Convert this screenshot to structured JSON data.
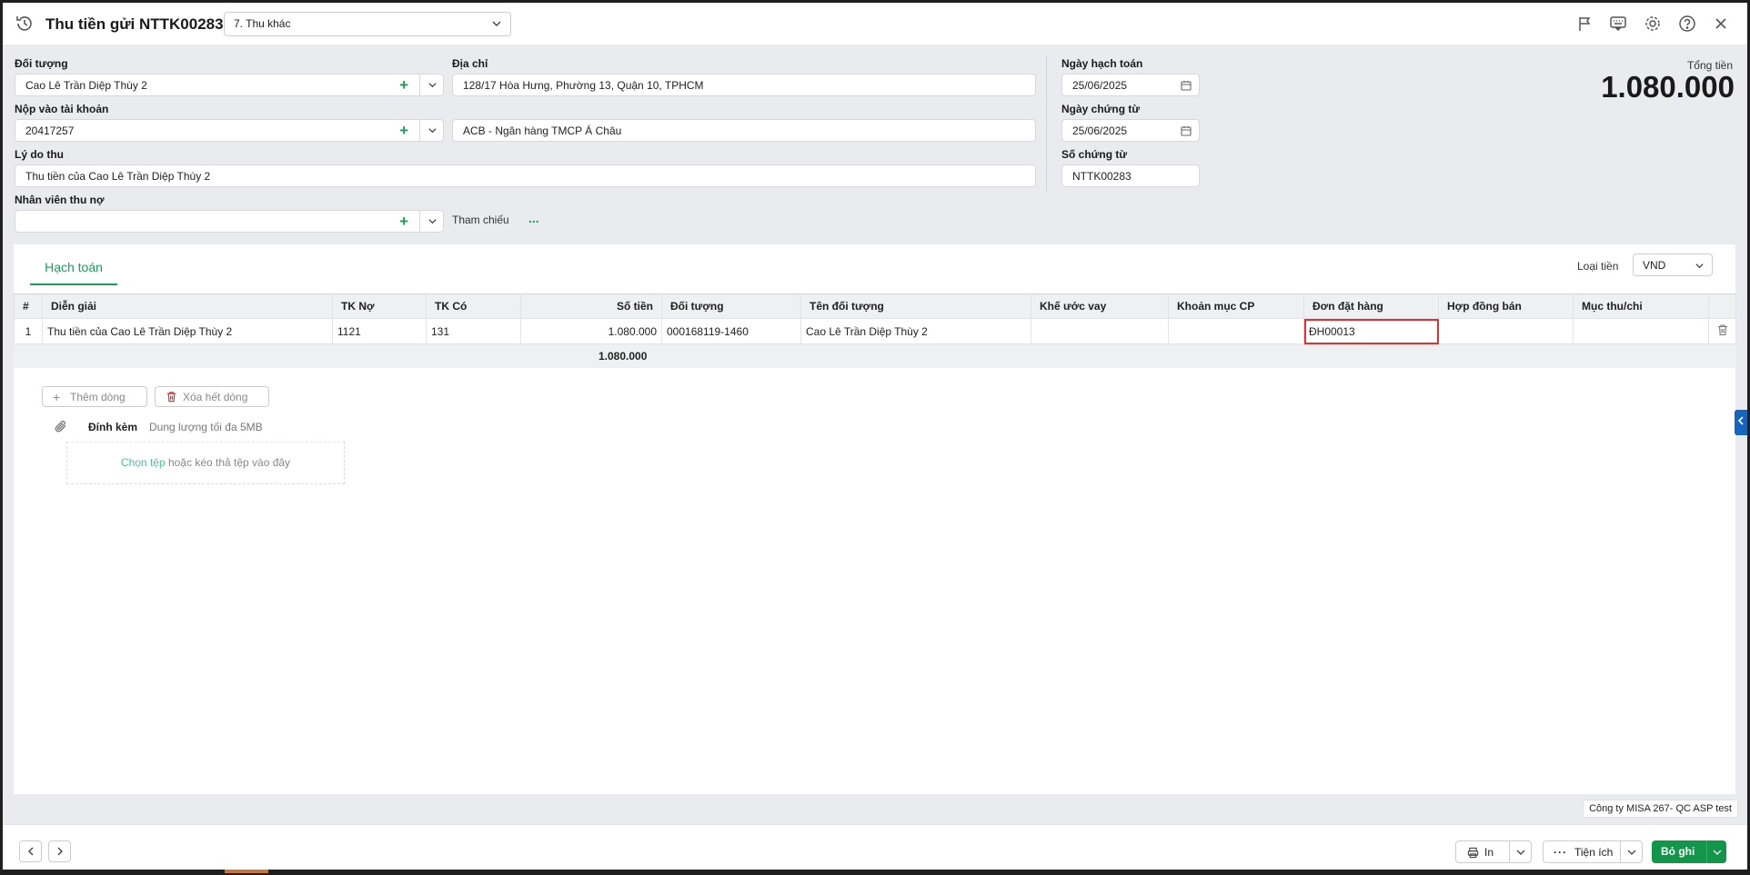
{
  "header": {
    "title": "Thu tiền gửi NTTK00283",
    "type_select": "7. Thu khác",
    "icons": [
      "history-icon",
      "flag-icon",
      "keyboard-icon",
      "settings-icon",
      "help-icon",
      "close-icon"
    ]
  },
  "form": {
    "doi_tuong_label": "Đối tượng",
    "doi_tuong_value": "Cao Lê Trần Diệp Thùy 2",
    "dia_chi_label": "Địa chỉ",
    "dia_chi_value": "128/17 Hòa Hưng, Phường 13, Quận 10, TPHCM",
    "nop_vao_label": "Nộp vào tài khoản",
    "nop_vao_value": "20417257",
    "bank_value": "ACB - Ngân hàng TMCP Á Châu",
    "ly_do_label": "Lý do thu",
    "ly_do_value": "Thu tiền của Cao Lê Trần Diệp Thùy 2",
    "nhan_vien_label": "Nhân viên thu nợ",
    "nhan_vien_value": "",
    "tham_chieu_label": "Tham chiếu",
    "tham_chieu_dots": "...",
    "ngay_hach_toan_label": "Ngày hạch toán",
    "ngay_hach_toan_value": "25/06/2025",
    "ngay_chung_tu_label": "Ngày chứng từ",
    "ngay_chung_tu_value": "25/06/2025",
    "so_chung_tu_label": "Số chứng từ",
    "so_chung_tu_value": "NTTK00283",
    "tong_tien_label": "Tổng tiền",
    "tong_tien_value": "1.080.000"
  },
  "panel": {
    "tab_label": "Hạch toán",
    "currency_label": "Loại tiền",
    "currency_value": "VND",
    "columns": [
      "#",
      "Diễn giải",
      "TK Nợ",
      "TK Có",
      "Số tiền",
      "Đối tượng",
      "Tên đối tượng",
      "Khế ước vay",
      "Khoản mục CP",
      "Đơn đặt hàng",
      "Hợp đồng bán",
      "Mục thu/chi"
    ],
    "rows": [
      {
        "no": "1",
        "dien_giai": "Thu tiền của Cao Lê Trần Diệp Thùy 2",
        "tk_no": "1121",
        "tk_co": "131",
        "so_tien": "1.080.000",
        "doi_tuong": "000168119-1460",
        "ten_doi_tuong": "Cao Lê Trần Diệp Thùy 2",
        "khe_uoc_vay": "",
        "khoan_muc_cp": "",
        "don_dat_hang": "ĐH00013",
        "hop_dong_ban": "",
        "muc_thu_chi": ""
      }
    ],
    "sum_so_tien": "1.080.000",
    "add_row_label": "Thêm dòng",
    "delete_all_label": "Xóa hết dòng",
    "attach_label": "Đính kèm",
    "attach_hint": "Dung lượng tối đa 5MB",
    "drop_link": "Chọn tệp",
    "drop_text": " hoặc kéo thả tệp vào đây"
  },
  "company": "Công ty MISA 267- QC ASP test",
  "footer": {
    "print_label": "In",
    "utility_label": "Tiện ích",
    "save_label": "Bỏ ghi"
  },
  "colors": {
    "accent": "#1a9f5b",
    "save_button": "#129649",
    "highlight": "#e0322f"
  }
}
